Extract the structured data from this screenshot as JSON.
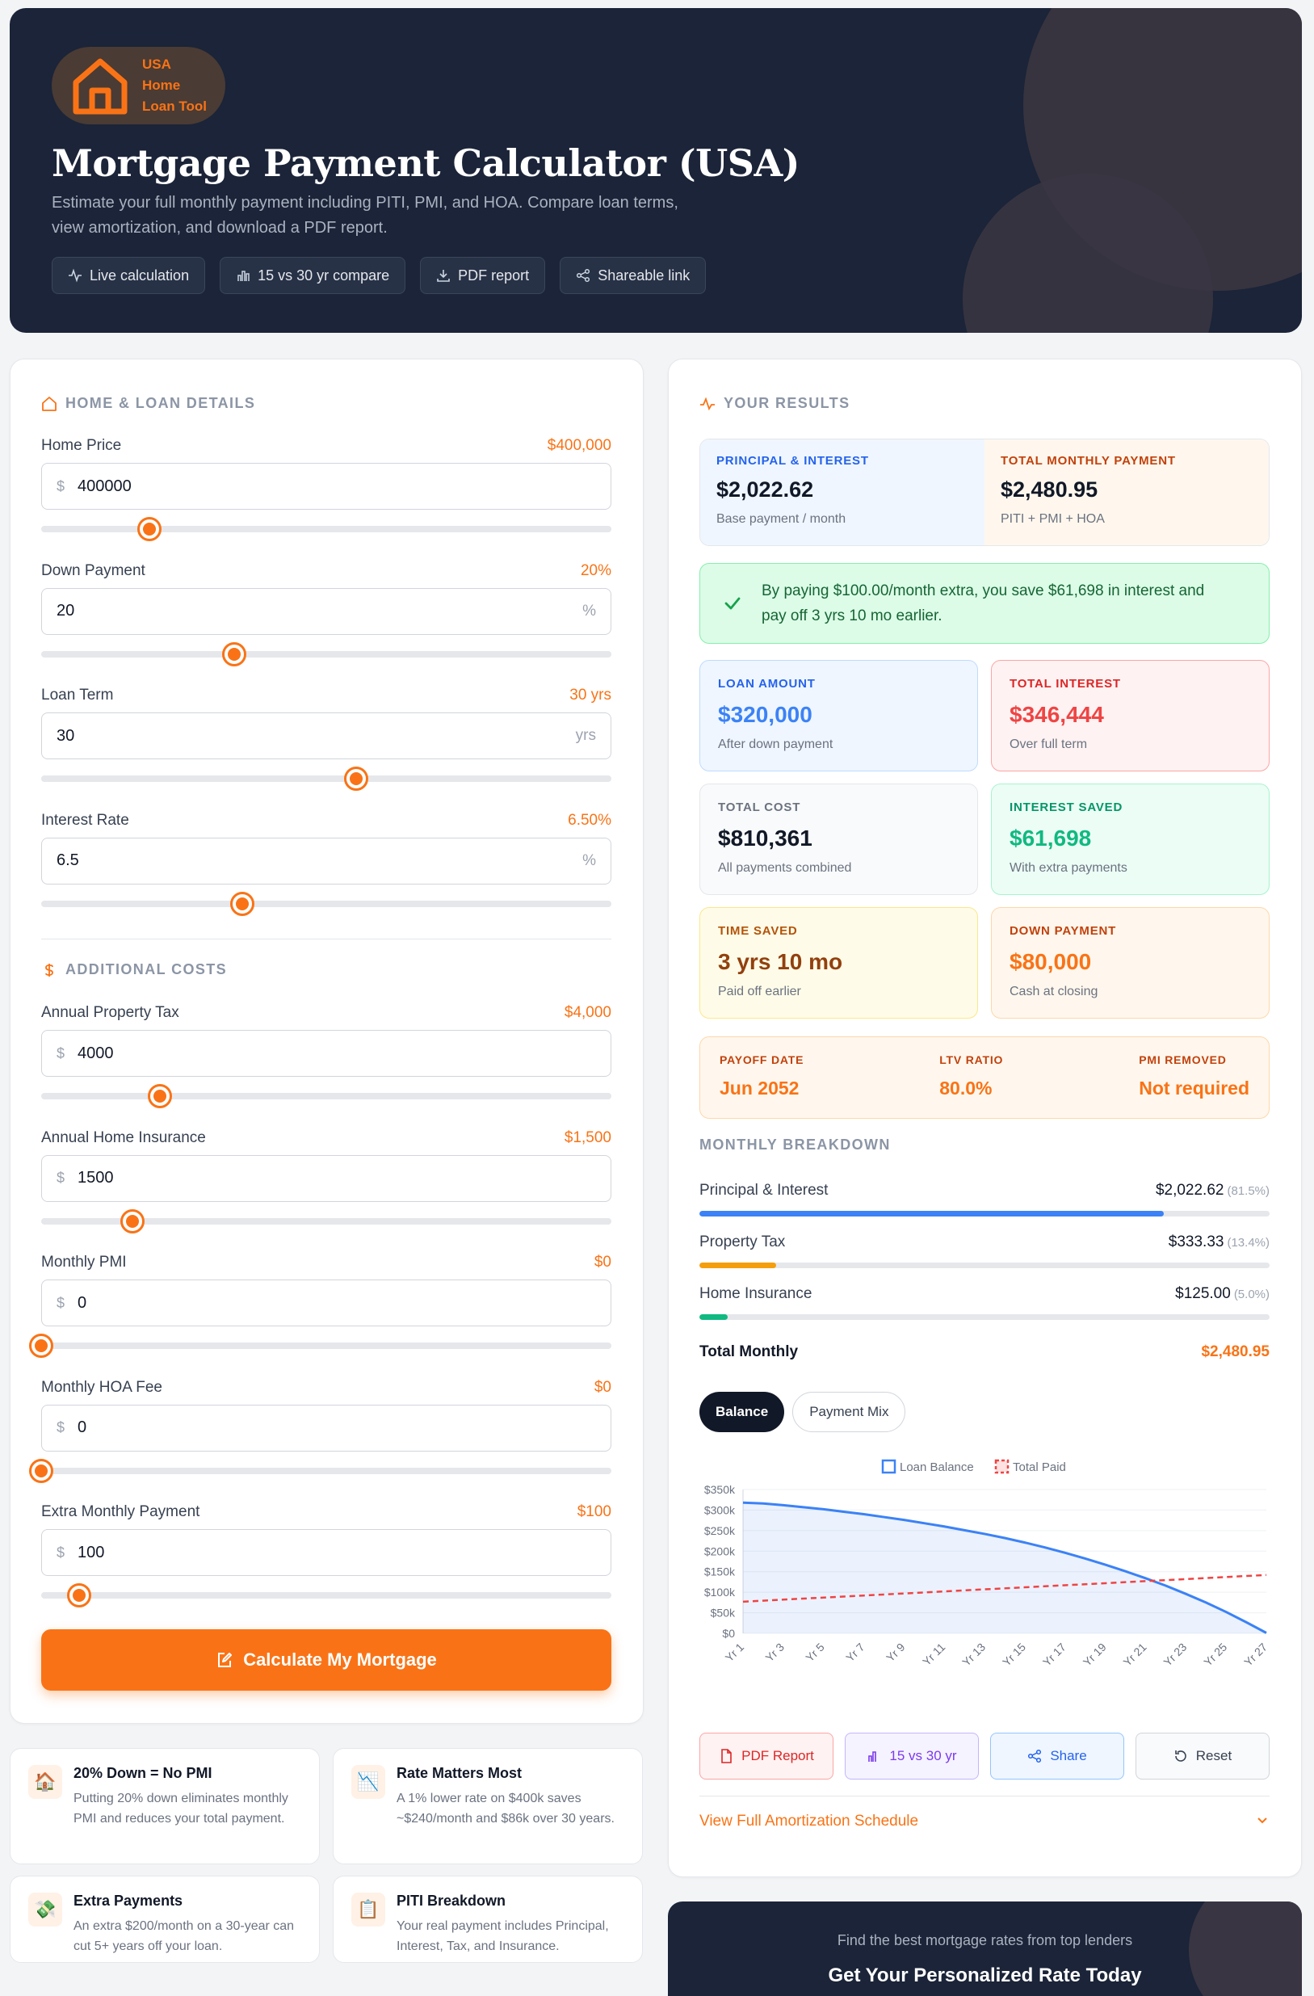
{
  "hero": {
    "brand": [
      "USA",
      "Home",
      "Loan Tool"
    ],
    "title": "Mortgage Payment Calculator (USA)",
    "subtitle_1": "Estimate your full monthly payment including PITI, PMI, and HOA. Compare loan terms,",
    "subtitle_2": "view amortization, and download a PDF report.",
    "pills": [
      "Live calculation",
      "15 vs 30 yr compare",
      "PDF report",
      "Shareable link"
    ]
  },
  "loan": {
    "section_title": "HOME & LOAN DETAILS",
    "fields": [
      {
        "label": "Home Price",
        "display": "$400,000",
        "value": "400000",
        "prefix": "$",
        "suffix": "",
        "fraction": 0.19
      },
      {
        "label": "Down Payment",
        "display": "20%",
        "value": "20",
        "prefix": "",
        "suffix": "%",
        "fraction": 0.338
      },
      {
        "label": "Loan Term",
        "display": "30 yrs",
        "value": "30",
        "prefix": "",
        "suffix": "yrs",
        "fraction": 0.553
      },
      {
        "label": "Interest Rate",
        "display": "6.50%",
        "value": "6.5",
        "prefix": "",
        "suffix": "%",
        "fraction": 0.352
      }
    ]
  },
  "costs": {
    "section_title": "ADDITIONAL COSTS",
    "fields": [
      {
        "label": "Annual Property Tax",
        "display": "$4,000",
        "value": "4000",
        "prefix": "$",
        "suffix": "",
        "fraction": 0.208
      },
      {
        "label": "Annual Home Insurance",
        "display": "$1,500",
        "value": "1500",
        "prefix": "$",
        "suffix": "",
        "fraction": 0.16
      },
      {
        "label": "Monthly PMI",
        "display": "$0",
        "value": "0",
        "prefix": "$",
        "suffix": "",
        "fraction": 0.0
      },
      {
        "label": "Monthly HOA Fee",
        "display": "$0",
        "value": "0",
        "prefix": "$",
        "suffix": "",
        "fraction": 0.0
      },
      {
        "label": "Extra Monthly Payment",
        "display": "$100",
        "value": "100",
        "prefix": "$",
        "suffix": "",
        "fraction": 0.066
      }
    ]
  },
  "calculate_label": "Calculate My Mortgage",
  "tips": [
    {
      "icon": "🏠",
      "title": "20% Down = No PMI",
      "desc": "Putting 20% down eliminates monthly PMI and reduces your total payment."
    },
    {
      "icon": "📉",
      "title": "Rate Matters Most",
      "desc": "A 1% lower rate on $400k saves ~$240/month and $86k over 30 years."
    },
    {
      "icon": "💸",
      "title": "Extra Payments",
      "desc": "An extra $200/month on a 30-year can cut 5+ years off your loan."
    },
    {
      "icon": "📋",
      "title": "PITI Breakdown",
      "desc": "Your real payment includes Principal, Interest, Tax, and Insurance."
    }
  ],
  "results": {
    "section_title": "YOUR RESULTS",
    "pi": {
      "label": "PRINCIPAL & INTEREST",
      "value": "$2,022.62",
      "sub": "Base payment / month"
    },
    "total": {
      "label": "TOTAL MONTHLY PAYMENT",
      "value": "$2,480.95",
      "sub": "PITI + PMI + HOA"
    },
    "savings_1": "By paying $100.00/month extra, you save $61,698 in interest and",
    "savings_2": "pay off 3 yrs 10 mo earlier.",
    "boxes": [
      {
        "label": "LOAN AMOUNT",
        "value": "$320,000",
        "sub": "After down payment"
      },
      {
        "label": "TOTAL INTEREST",
        "value": "$346,444",
        "sub": "Over full term"
      },
      {
        "label": "TOTAL COST",
        "value": "$810,361",
        "sub": "All payments combined"
      },
      {
        "label": "INTEREST SAVED",
        "value": "$61,698",
        "sub": "With extra payments"
      },
      {
        "label": "TIME SAVED",
        "value": "3 yrs 10 mo",
        "sub": "Paid off earlier"
      },
      {
        "label": "DOWN PAYMENT",
        "value": "$80,000",
        "sub": "Cash at closing"
      }
    ],
    "stats": [
      {
        "label": "PAYOFF DATE",
        "value": "Jun 2052"
      },
      {
        "label": "LTV RATIO",
        "value": "80.0%"
      },
      {
        "label": "PMI REMOVED",
        "value": "Not required"
      }
    ],
    "breakdown_title": "MONTHLY BREAKDOWN",
    "breakdown": [
      {
        "label": "Principal & Interest",
        "amount": "$2,022.62",
        "pct": "(81.5%)",
        "fraction": 0.815
      },
      {
        "label": "Property Tax",
        "amount": "$333.33",
        "pct": "(13.4%)",
        "fraction": 0.134
      },
      {
        "label": "Home Insurance",
        "amount": "$125.00",
        "pct": "(5.0%)",
        "fraction": 0.05
      }
    ],
    "total_label": "Total Monthly",
    "total_value": "$2,480.95",
    "tabs": [
      "Balance",
      "Payment Mix"
    ],
    "actions": [
      "PDF Report",
      "15 vs 30 yr",
      "Share",
      "Reset"
    ],
    "amort_label": "View Full Amortization Schedule"
  },
  "colors": {
    "accent": "#f97316",
    "pi": "#3b82f6",
    "tax": "#f59e0b",
    "insurance": "#10b981"
  },
  "chart_data": {
    "type": "line",
    "legend": [
      "Loan Balance",
      "Total Paid"
    ],
    "legend_position": "top-center",
    "x": [
      "Yr 1",
      "Yr 2",
      "Yr 3",
      "Yr 4",
      "Yr 5",
      "Yr 6",
      "Yr 7",
      "Yr 8",
      "Yr 9",
      "Yr 10",
      "Yr 11",
      "Yr 12",
      "Yr 13",
      "Yr 14",
      "Yr 15",
      "Yr 16",
      "Yr 17",
      "Yr 18",
      "Yr 19",
      "Yr 20",
      "Yr 21",
      "Yr 22",
      "Yr 23",
      "Yr 24",
      "Yr 25",
      "Yr 26",
      "Yr 27"
    ],
    "x_tick_labels": [
      "Yr 1",
      "Yr 3",
      "Yr 5",
      "Yr 7",
      "Yr 9",
      "Yr 11",
      "Yr 13",
      "Yr 15",
      "Yr 17",
      "Yr 19",
      "Yr 21",
      "Yr 23",
      "Yr 25",
      "Yr 27"
    ],
    "series": [
      {
        "name": "Loan Balance",
        "values": [
          318000,
          316000,
          312000,
          307000,
          302000,
          296000,
          290000,
          283000,
          276000,
          268000,
          260000,
          251000,
          242000,
          232000,
          221000,
          209000,
          196000,
          182000,
          167000,
          151000,
          134000,
          116000,
          96000,
          75000,
          52000,
          27000,
          1000
        ]
      },
      {
        "name": "Total Paid",
        "values": [
          77000,
          79500,
          82000,
          84500,
          87000,
          89500,
          92000,
          94500,
          97000,
          99500,
          102000,
          104500,
          107000,
          109500,
          112000,
          114500,
          117000,
          119500,
          122000,
          124500,
          127000,
          129500,
          132000,
          134500,
          137000,
          139500,
          142000
        ]
      }
    ],
    "y_tick_labels": [
      "$0",
      "$50k",
      "$100k",
      "$150k",
      "$200k",
      "$250k",
      "$300k",
      "$350k"
    ],
    "ylim": [
      0,
      350000
    ],
    "grid": true
  }
}
